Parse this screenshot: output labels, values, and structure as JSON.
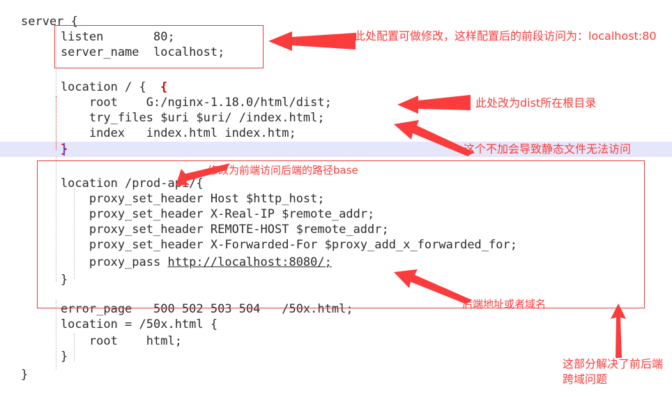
{
  "editor": {
    "name": "nginx-conf-editor",
    "language": "nginx",
    "highlight_color": "#e6e6fa",
    "annotation_color": "#fa3c3c",
    "box_color": "#e03b3b",
    "code_lines": [
      {
        "id": "l1",
        "text": "server {"
      },
      {
        "id": "l2",
        "text": "    listen       80;"
      },
      {
        "id": "l3",
        "text": "    server_name  localhost;"
      },
      {
        "id": "l4",
        "text": ""
      },
      {
        "id": "l5",
        "text": "    location / {",
        "brace": "{"
      },
      {
        "id": "l6",
        "text": "        root    G:/nginx-1.18.0/html/dist;"
      },
      {
        "id": "l7",
        "text": "        try_files $uri $uri/ /index.html;"
      },
      {
        "id": "l8",
        "text": "        index   index.html index.htm;"
      },
      {
        "id": "l9",
        "text": "    }",
        "brace": "}",
        "highlighted": true
      },
      {
        "id": "l10",
        "text": ""
      },
      {
        "id": "l11",
        "text": "    location /prod-api/{"
      },
      {
        "id": "l12",
        "text": "        proxy_set_header Host $http_host;"
      },
      {
        "id": "l13",
        "text": "        proxy_set_header X-Real-IP $remote_addr;"
      },
      {
        "id": "l14",
        "text": "        proxy_set_header REMOTE-HOST $remote_addr;"
      },
      {
        "id": "l15",
        "text": "        proxy_set_header X-Forwarded-For $proxy_add_x_forwarded_for;"
      },
      {
        "id": "l16",
        "text": "        proxy_pass ",
        "link": "http://localhost:8080/;"
      },
      {
        "id": "l17",
        "text": "    }"
      },
      {
        "id": "l18",
        "text": ""
      },
      {
        "id": "l19",
        "text": "    error_page   500 502 503 504   /50x.html;"
      },
      {
        "id": "l20",
        "text": "    location = /50x.html {"
      },
      {
        "id": "l21",
        "text": "        root    html;"
      },
      {
        "id": "l22",
        "text": "    }"
      },
      {
        "id": "l23",
        "text": "}"
      }
    ]
  },
  "annotations": [
    {
      "id": "a1",
      "name": "listen-port-note",
      "text": "此处配置可做修改，这样配置后的前段访问为：localhost:80"
    },
    {
      "id": "a2",
      "name": "root-dist-note",
      "text": "此处改为dist所在根目录"
    },
    {
      "id": "a3",
      "name": "try-files-note",
      "text": "这个不加会导致静态文件无法访问"
    },
    {
      "id": "a4",
      "name": "prod-api-base-note",
      "text": "修改为前端访问后端的路径base"
    },
    {
      "id": "a5",
      "name": "backend-address-note",
      "text": "后端地址或者域名"
    },
    {
      "id": "a6",
      "name": "cors-note-line1",
      "text": "这部分解决了前后端"
    },
    {
      "id": "a7",
      "name": "cors-note-line2",
      "text": "跨域问题"
    }
  ]
}
